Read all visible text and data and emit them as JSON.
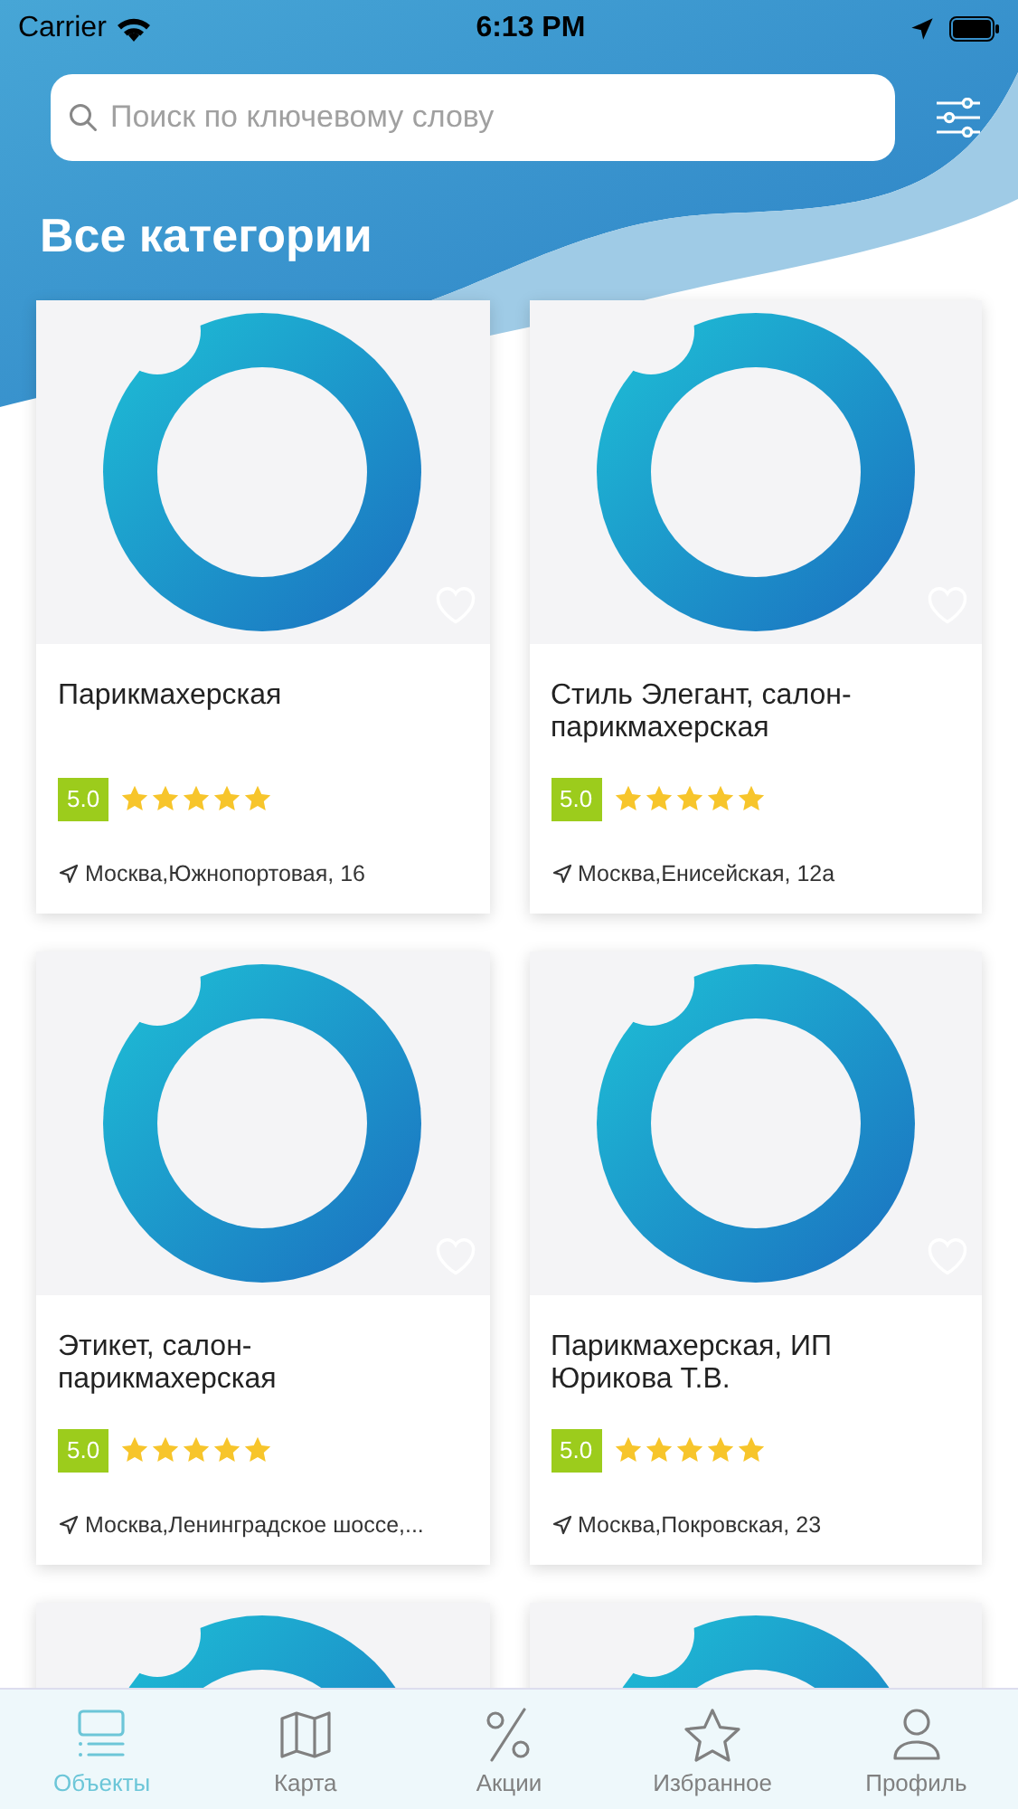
{
  "status_bar": {
    "carrier": "Carrier",
    "time": "6:13 PM"
  },
  "search": {
    "placeholder": "Поиск по ключевому слову"
  },
  "heading": "Все категории",
  "cards": [
    {
      "kind": "full",
      "title": "Парикмахерская",
      "rating": "5.0",
      "stars": 5,
      "address": "Москва,Южнопортовая, 16",
      "favorite": false
    },
    {
      "kind": "full",
      "title": "Стиль Элегант, салон-парикмахерская",
      "rating": "5.0",
      "stars": 5,
      "address": "Москва,Енисейская, 12а",
      "favorite": false
    },
    {
      "kind": "full",
      "title": "Этикет, салон-парикмахерская",
      "rating": "5.0",
      "stars": 5,
      "address": "Москва,Ленинградское шоссе,...",
      "favorite": false
    },
    {
      "kind": "full",
      "title": "Парикмахерская, ИП Юрикова Т.В.",
      "rating": "5.0",
      "stars": 5,
      "address": "Москва,Покровская, 23",
      "favorite": false
    },
    {
      "kind": "partial"
    },
    {
      "kind": "partial"
    }
  ],
  "tabs": [
    {
      "kind": "list",
      "label": "Объекты",
      "selected": true
    },
    {
      "kind": "map",
      "label": "Карта",
      "selected": false
    },
    {
      "kind": "percent",
      "label": "Акции",
      "selected": false
    },
    {
      "kind": "star",
      "label": "Избранное",
      "selected": false
    },
    {
      "kind": "profile",
      "label": "Профиль",
      "selected": false
    }
  ]
}
